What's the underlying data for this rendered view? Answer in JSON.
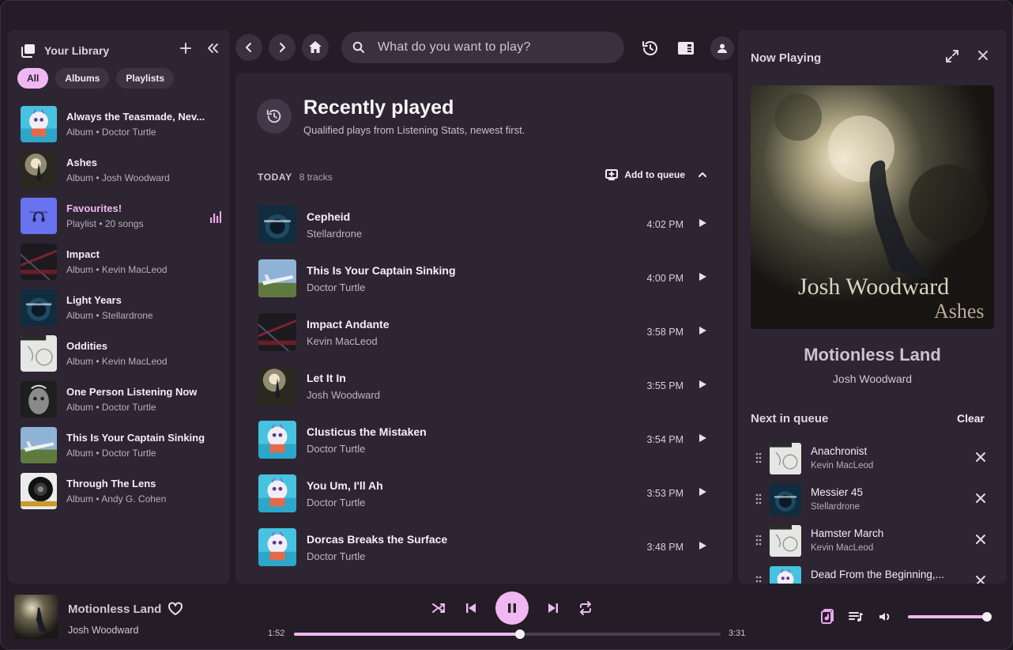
{
  "colors": {
    "accent": "#efb8f2",
    "panel": "#2e2532",
    "window": "#241c27"
  },
  "sidebar": {
    "title": "Your Library",
    "filters": [
      "All",
      "Albums",
      "Playlists"
    ],
    "active_filter": "All",
    "items": [
      {
        "name": "Always the Teasmade, Nev...",
        "sub": "Album • Doctor Turtle",
        "art": "turtle"
      },
      {
        "name": "Ashes",
        "sub": "Album • Josh Woodward",
        "art": "ashes"
      },
      {
        "name": "Favourites!",
        "sub": "Playlist • 20 songs",
        "art": "fav",
        "playing": true
      },
      {
        "name": "Impact",
        "sub": "Album • Kevin MacLeod",
        "art": "impact"
      },
      {
        "name": "Light Years",
        "sub": "Album • Stellardrone",
        "art": "stellar"
      },
      {
        "name": "Oddities",
        "sub": "Album • Kevin MacLeod",
        "art": "scoring"
      },
      {
        "name": "One Person Listening Now",
        "sub": "Album • Doctor Turtle",
        "art": "face"
      },
      {
        "name": "This Is Your Captain Sinking",
        "sub": "Album • Doctor Turtle",
        "art": "plane"
      },
      {
        "name": "Through The Lens",
        "sub": "Album • Andy G. Cohen",
        "art": "lens"
      }
    ]
  },
  "search": {
    "placeholder": "What do you want to play?"
  },
  "main": {
    "title": "Recently played",
    "subtitle": "Qualified plays from Listening Stats, newest first.",
    "section_day": "TODAY",
    "section_count": "8 tracks",
    "add_to_queue": "Add to queue",
    "tracks": [
      {
        "title": "Cepheid",
        "artist": "Stellardrone",
        "time": "4:02 PM",
        "art": "stellar"
      },
      {
        "title": "This Is Your Captain Sinking",
        "artist": "Doctor Turtle",
        "time": "4:00 PM",
        "art": "plane"
      },
      {
        "title": "Impact Andante",
        "artist": "Kevin MacLeod",
        "time": "3:58 PM",
        "art": "impact"
      },
      {
        "title": "Let It In",
        "artist": "Josh Woodward",
        "time": "3:55 PM",
        "art": "ashes"
      },
      {
        "title": "Clusticus the Mistaken",
        "artist": "Doctor Turtle",
        "time": "3:54 PM",
        "art": "turtle"
      },
      {
        "title": "You Um, I'll Ah",
        "artist": "Doctor Turtle",
        "time": "3:53 PM",
        "art": "turtle"
      },
      {
        "title": "Dorcas Breaks the Surface",
        "artist": "Doctor Turtle",
        "time": "3:48 PM",
        "art": "turtle"
      }
    ]
  },
  "now_playing": {
    "panel_title": "Now Playing",
    "cover_artist_text": "Josh Woodward",
    "cover_album_text": "Ashes",
    "song": "Motionless Land",
    "artist": "Josh Woodward",
    "queue_title": "Next in queue",
    "clear_label": "Clear",
    "queue": [
      {
        "title": "Anachronist",
        "artist": "Kevin MacLeod",
        "art": "scoring"
      },
      {
        "title": "Messier 45",
        "artist": "Stellardrone",
        "art": "stellar"
      },
      {
        "title": "Hamster March",
        "artist": "Kevin MacLeod",
        "art": "scoring"
      },
      {
        "title": "Dead From the Beginning,...",
        "artist": "",
        "art": "turtle"
      }
    ]
  },
  "player": {
    "song": "Motionless Land",
    "artist": "Josh Woodward",
    "current_time": "1:52",
    "total_time": "3:31",
    "progress": 0.53,
    "volume": 1.0
  }
}
